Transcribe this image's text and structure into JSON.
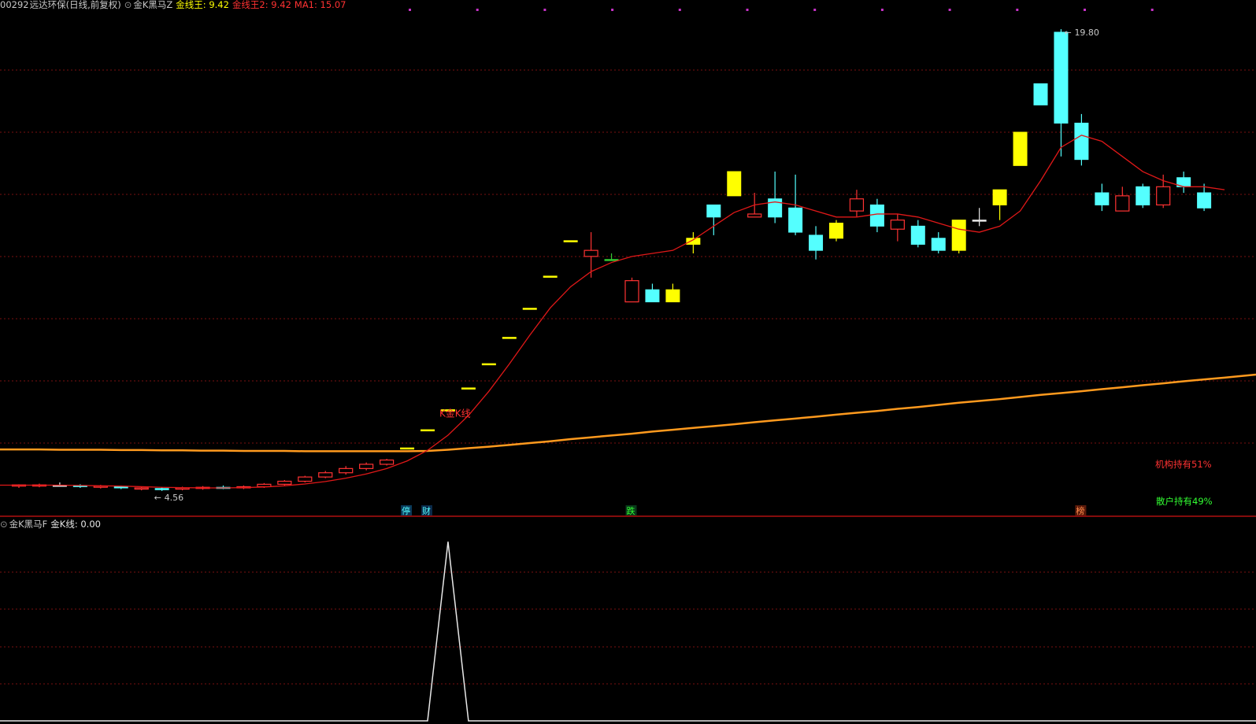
{
  "header": {
    "code": "00292",
    "name": "远达环保",
    "period": "(日线,前复权)",
    "indicator": "金K黑马Z",
    "jxw_label": "金线王: 9.42",
    "jxw2_label": "金线王2: 9.42",
    "ma1_label": "MA1: 15.07"
  },
  "sub_header": {
    "indicator": "金K黑马F",
    "value_label": "金K线: 0.00"
  },
  "annotations": {
    "high_label": "19.80",
    "low_label": "4.56",
    "golden_k_label": "K金K线",
    "inst_label": "机构持有51%",
    "retail_label": "散户持有49%",
    "markers": [
      "停",
      "财",
      "跌",
      "榜"
    ]
  },
  "colors": {
    "up": "#ff3232",
    "down": "#54ffff",
    "gold": "#ffff00",
    "ma": "#e01818",
    "long_ma": "#ff9a1e",
    "grid": "#7a1010",
    "separator": "#b01010"
  },
  "chart_data": {
    "type": "candlestick",
    "y_range": [
      4.4,
      20.4
    ],
    "high": 19.8,
    "low": 4.56,
    "candles": [
      {
        "o": 4.72,
        "h": 4.78,
        "l": 4.66,
        "c": 4.76,
        "k": "up"
      },
      {
        "o": 4.76,
        "h": 4.8,
        "l": 4.68,
        "c": 4.75,
        "k": "up"
      },
      {
        "o": 4.75,
        "h": 4.84,
        "l": 4.7,
        "c": 4.74,
        "k": "flat"
      },
      {
        "o": 4.74,
        "h": 4.78,
        "l": 4.66,
        "c": 4.72,
        "k": "down"
      },
      {
        "o": 4.72,
        "h": 4.76,
        "l": 4.64,
        "c": 4.7,
        "k": "up"
      },
      {
        "o": 4.7,
        "h": 4.74,
        "l": 4.62,
        "c": 4.66,
        "k": "down"
      },
      {
        "o": 4.66,
        "h": 4.7,
        "l": 4.58,
        "c": 4.64,
        "k": "up"
      },
      {
        "o": 4.64,
        "h": 4.68,
        "l": 4.56,
        "c": 4.62,
        "k": "down"
      },
      {
        "o": 4.62,
        "h": 4.7,
        "l": 4.58,
        "c": 4.66,
        "k": "up"
      },
      {
        "o": 4.66,
        "h": 4.72,
        "l": 4.6,
        "c": 4.68,
        "k": "up"
      },
      {
        "o": 4.68,
        "h": 4.74,
        "l": 4.62,
        "c": 4.66,
        "k": "down"
      },
      {
        "o": 4.66,
        "h": 4.74,
        "l": 4.62,
        "c": 4.7,
        "k": "up"
      },
      {
        "o": 4.7,
        "h": 4.82,
        "l": 4.66,
        "c": 4.78,
        "k": "up"
      },
      {
        "o": 4.78,
        "h": 4.92,
        "l": 4.74,
        "c": 4.88,
        "k": "up"
      },
      {
        "o": 4.88,
        "h": 5.06,
        "l": 4.84,
        "c": 5.02,
        "k": "up"
      },
      {
        "o": 5.02,
        "h": 5.22,
        "l": 4.98,
        "c": 5.16,
        "k": "up"
      },
      {
        "o": 5.16,
        "h": 5.38,
        "l": 5.1,
        "c": 5.3,
        "k": "up"
      },
      {
        "o": 5.3,
        "h": 5.5,
        "l": 5.24,
        "c": 5.44,
        "k": "up"
      },
      {
        "o": 5.44,
        "h": 5.62,
        "l": 5.4,
        "c": 5.58,
        "k": "up"
      },
      {
        "o": 5.98,
        "h": 5.98,
        "l": 5.98,
        "c": 5.98,
        "k": "gold"
      },
      {
        "o": 6.58,
        "h": 6.58,
        "l": 6.58,
        "c": 6.58,
        "k": "gold"
      },
      {
        "o": 7.24,
        "h": 7.24,
        "l": 7.24,
        "c": 7.24,
        "k": "gold"
      },
      {
        "o": 7.96,
        "h": 7.96,
        "l": 7.96,
        "c": 7.96,
        "k": "gold"
      },
      {
        "o": 8.76,
        "h": 8.76,
        "l": 8.76,
        "c": 8.76,
        "k": "gold"
      },
      {
        "o": 9.63,
        "h": 9.63,
        "l": 9.63,
        "c": 9.63,
        "k": "gold"
      },
      {
        "o": 10.59,
        "h": 10.59,
        "l": 10.59,
        "c": 10.59,
        "k": "gold"
      },
      {
        "o": 11.65,
        "h": 11.65,
        "l": 11.65,
        "c": 11.65,
        "k": "gold"
      },
      {
        "o": 12.82,
        "h": 12.82,
        "l": 12.82,
        "c": 12.82,
        "k": "gold"
      },
      {
        "o": 12.3,
        "h": 13.1,
        "l": 11.6,
        "c": 12.5,
        "k": "up"
      },
      {
        "o": 12.2,
        "h": 12.4,
        "l": 12.2,
        "c": 12.2,
        "k": "green"
      },
      {
        "o": 10.8,
        "h": 11.6,
        "l": 10.8,
        "c": 11.5,
        "k": "up"
      },
      {
        "o": 11.2,
        "h": 11.4,
        "l": 10.8,
        "c": 10.8,
        "k": "down"
      },
      {
        "o": 11.2,
        "h": 11.4,
        "l": 10.8,
        "c": 10.8,
        "k": "gold"
      },
      {
        "o": 12.9,
        "h": 13.1,
        "l": 12.4,
        "c": 12.7,
        "k": "gold"
      },
      {
        "o": 14.0,
        "h": 14.0,
        "l": 13.0,
        "c": 13.6,
        "k": "down"
      },
      {
        "o": 15.1,
        "h": 15.1,
        "l": 14.3,
        "c": 14.3,
        "k": "gold"
      },
      {
        "o": 13.6,
        "h": 14.4,
        "l": 13.6,
        "c": 13.7,
        "k": "up"
      },
      {
        "o": 14.2,
        "h": 15.1,
        "l": 13.4,
        "c": 13.6,
        "k": "down"
      },
      {
        "o": 13.9,
        "h": 15.0,
        "l": 13.0,
        "c": 13.1,
        "k": "down"
      },
      {
        "o": 13.0,
        "h": 13.3,
        "l": 12.2,
        "c": 12.5,
        "k": "down"
      },
      {
        "o": 13.4,
        "h": 13.5,
        "l": 12.8,
        "c": 12.9,
        "k": "gold"
      },
      {
        "o": 13.8,
        "h": 14.5,
        "l": 13.6,
        "c": 14.2,
        "k": "up"
      },
      {
        "o": 14.0,
        "h": 14.2,
        "l": 13.1,
        "c": 13.3,
        "k": "down"
      },
      {
        "o": 13.2,
        "h": 13.7,
        "l": 12.8,
        "c": 13.5,
        "k": "up"
      },
      {
        "o": 13.3,
        "h": 13.5,
        "l": 12.6,
        "c": 12.7,
        "k": "down"
      },
      {
        "o": 12.9,
        "h": 13.1,
        "l": 12.4,
        "c": 12.5,
        "k": "down"
      },
      {
        "o": 12.5,
        "h": 13.5,
        "l": 12.4,
        "c": 13.5,
        "k": "gold"
      },
      {
        "o": 13.5,
        "h": 13.9,
        "l": 13.3,
        "c": 13.5,
        "k": "flat"
      },
      {
        "o": 14.0,
        "h": 14.5,
        "l": 13.5,
        "c": 14.5,
        "k": "gold"
      },
      {
        "o": 16.4,
        "h": 16.4,
        "l": 15.3,
        "c": 15.3,
        "k": "gold"
      },
      {
        "o": 18.0,
        "h": 18.0,
        "l": 17.3,
        "c": 17.3,
        "k": "down"
      },
      {
        "o": 19.7,
        "h": 19.8,
        "l": 15.6,
        "c": 16.7,
        "k": "down"
      },
      {
        "o": 16.7,
        "h": 17.0,
        "l": 15.3,
        "c": 15.5,
        "k": "down"
      },
      {
        "o": 14.4,
        "h": 14.7,
        "l": 13.8,
        "c": 14.0,
        "k": "down"
      },
      {
        "o": 13.8,
        "h": 14.6,
        "l": 13.8,
        "c": 14.3,
        "k": "up"
      },
      {
        "o": 14.6,
        "h": 14.7,
        "l": 13.9,
        "c": 14.0,
        "k": "down"
      },
      {
        "o": 14.0,
        "h": 15.0,
        "l": 13.9,
        "c": 14.6,
        "k": "up"
      },
      {
        "o": 14.9,
        "h": 15.1,
        "l": 14.4,
        "c": 14.6,
        "k": "down"
      },
      {
        "o": 14.4,
        "h": 14.7,
        "l": 13.8,
        "c": 13.9,
        "k": "down"
      }
    ],
    "ma": [
      4.75,
      4.75,
      4.75,
      4.74,
      4.73,
      4.72,
      4.7,
      4.68,
      4.67,
      4.66,
      4.66,
      4.67,
      4.69,
      4.73,
      4.79,
      4.87,
      4.98,
      5.12,
      5.3,
      5.55,
      5.9,
      6.4,
      7.05,
      7.85,
      8.75,
      9.7,
      10.6,
      11.3,
      11.8,
      12.1,
      12.3,
      12.4,
      12.5,
      12.85,
      13.3,
      13.75,
      14.0,
      14.1,
      14.0,
      13.8,
      13.6,
      13.6,
      13.7,
      13.7,
      13.6,
      13.4,
      13.2,
      13.1,
      13.3,
      13.8,
      14.8,
      15.9,
      16.3,
      16.1,
      15.6,
      15.1,
      14.8,
      14.6,
      14.6,
      14.5
    ],
    "ma_long": [
      5.93,
      5.93,
      5.92,
      5.92,
      5.92,
      5.91,
      5.91,
      5.9,
      5.9,
      5.89,
      5.89,
      5.88,
      5.88,
      5.88,
      5.87,
      5.87,
      5.87,
      5.87,
      5.87,
      5.87,
      5.88,
      5.92,
      5.97,
      6.02,
      6.08,
      6.14,
      6.2,
      6.27,
      6.33,
      6.39,
      6.45,
      6.52,
      6.58,
      6.64,
      6.7,
      6.76,
      6.83,
      6.89,
      6.95,
      7.01,
      7.08,
      7.14,
      7.2,
      7.27,
      7.33,
      7.4,
      7.47,
      7.53,
      7.59,
      7.66,
      7.73,
      7.79,
      7.85,
      7.92,
      7.98,
      8.05,
      8.11,
      8.18,
      8.24,
      8.3
    ],
    "signal": {
      "index": 21,
      "value": 1,
      "range": [
        0,
        1.05
      ]
    },
    "marker_positions": [
      19,
      20,
      30,
      52
    ]
  }
}
